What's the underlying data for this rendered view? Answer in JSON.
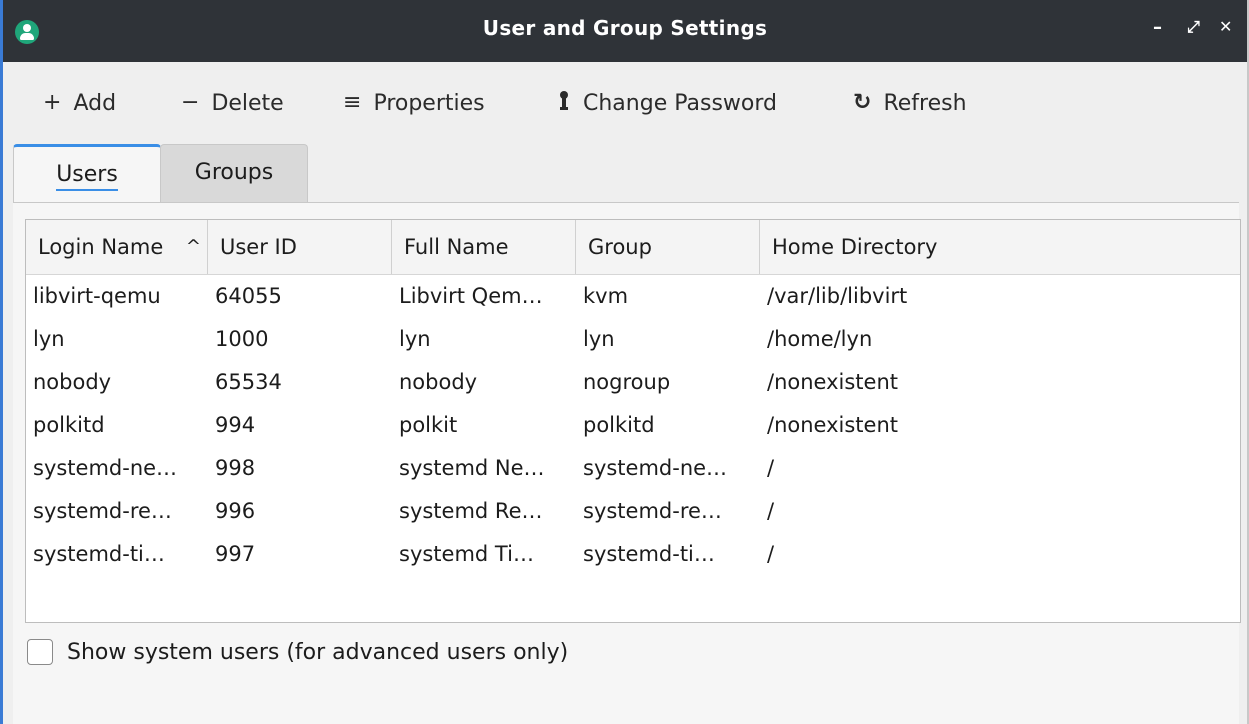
{
  "window": {
    "title": "User and Group Settings",
    "controls": {
      "minimize": "–",
      "maximize": "⤢",
      "close": "✕"
    }
  },
  "toolbar": {
    "add": {
      "icon": "+",
      "label": "Add"
    },
    "delete": {
      "icon": "−",
      "label": "Delete"
    },
    "properties": {
      "icon": "≡",
      "label": "Properties"
    },
    "change_password": {
      "icon": "🔑",
      "label": "Change Password"
    },
    "refresh": {
      "icon": "↻",
      "label": "Refresh"
    }
  },
  "tabs": [
    {
      "label": "Users",
      "active": true
    },
    {
      "label": "Groups",
      "active": false
    }
  ],
  "table": {
    "columns": [
      "Login Name",
      "User ID",
      "Full Name",
      "Group",
      "Home Directory"
    ],
    "sort_indicator": "^",
    "rows": [
      [
        "libvirt-qemu",
        "64055",
        "Libvirt Qem…",
        "kvm",
        "/var/lib/libvirt"
      ],
      [
        "lyn",
        "1000",
        "lyn",
        "lyn",
        "/home/lyn"
      ],
      [
        "nobody",
        "65534",
        "nobody",
        "nogroup",
        "/nonexistent"
      ],
      [
        "polkitd",
        "994",
        "polkit",
        "polkitd",
        "/nonexistent"
      ],
      [
        "systemd-ne…",
        "998",
        "systemd Ne…",
        "systemd-ne…",
        "/"
      ],
      [
        "systemd-re…",
        "996",
        "systemd Re…",
        "systemd-re…",
        "/"
      ],
      [
        "systemd-ti…",
        "997",
        "systemd Ti…",
        "systemd-ti…",
        "/"
      ]
    ]
  },
  "show_system_users": {
    "label": "Show system users (for advanced users only)",
    "checked": false
  },
  "colors": {
    "titlebar": "#2f3338",
    "accent": "#3a8ee6",
    "app_icon": "#1fa67a"
  }
}
